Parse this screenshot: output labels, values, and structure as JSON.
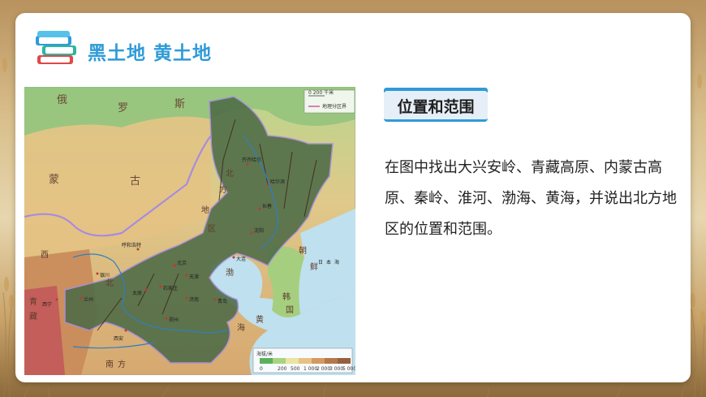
{
  "header": {
    "title": "黑土地 黄土地"
  },
  "tag": {
    "label": "位置和范围"
  },
  "body": {
    "paragraph": "在图中找出大兴安岭、青藏高原、内蒙古高原、秦岭、淮河、渤海、黄海，并说出北方地区的位置和范围。"
  },
  "map": {
    "region_labels": [
      "俄",
      "罗",
      "斯",
      "蒙",
      "古",
      "北",
      "方",
      "地",
      "区",
      "西",
      "北",
      "朝",
      "鲜",
      "日",
      "本",
      "海",
      "韩",
      "国",
      "黄",
      "渤",
      "海",
      "青",
      "藏",
      "南",
      "方"
    ],
    "cities": [
      "哈尔滨",
      "长春",
      "沈阳",
      "北京",
      "天津",
      "呼和浩特",
      "石家庄",
      "太原",
      "济南",
      "郑州",
      "西安",
      "银川",
      "兰州",
      "西宁",
      "齐齐哈尔",
      "大连",
      "青岛"
    ],
    "scale_text": "0      200 千米",
    "boundary_legend": "地理分区界",
    "elevation_legend": {
      "title": "海拔/米",
      "ticks": [
        "0",
        "200",
        "500",
        "1 000",
        "2 000",
        "3 000",
        "5 000"
      ],
      "colors": [
        "#5bb05b",
        "#a7d480",
        "#e9e4a0",
        "#e7c182",
        "#d29a62",
        "#b5774a",
        "#95603f"
      ]
    },
    "colors": {
      "sea": "#bfe0ee",
      "land_low": "#c6dd95",
      "highland": "#e3b873",
      "north_region": "#4d6b46",
      "boundary": "#a88be0",
      "river": "#2e7fc4"
    }
  },
  "colors": {
    "accent": "#2f9bd8"
  }
}
